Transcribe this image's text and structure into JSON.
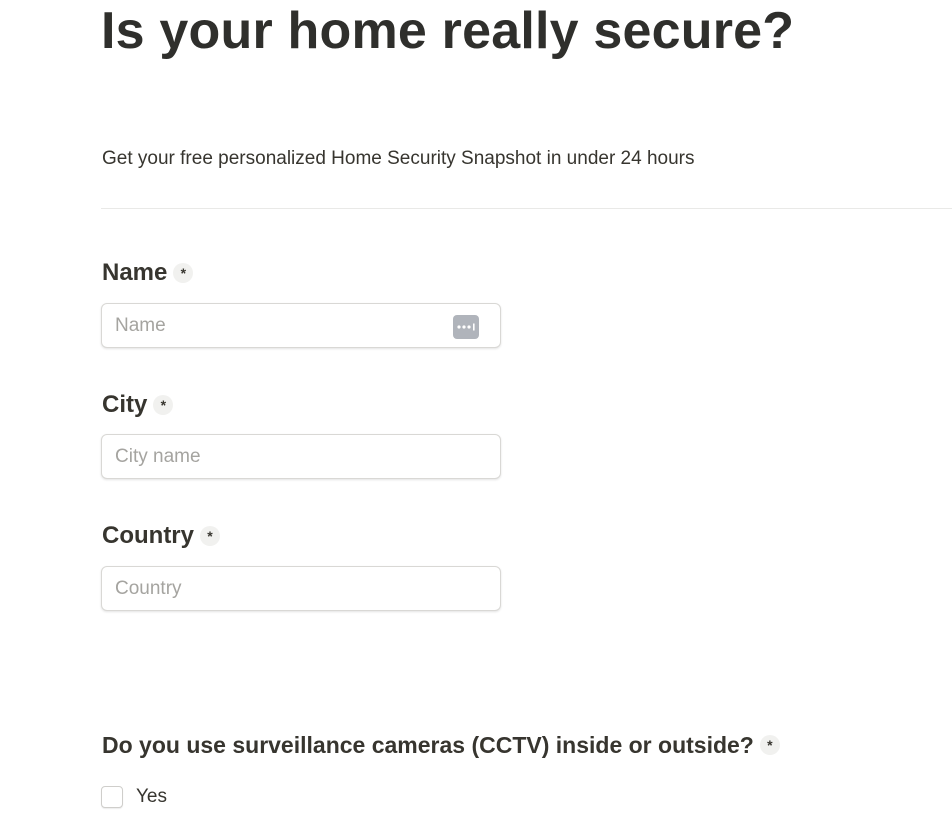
{
  "form": {
    "title": "Is your home really secure?",
    "subtitle": "Get your free personalized Home Security Snapshot in under 24 hours",
    "required_marker": "*",
    "fields": [
      {
        "label": "Name",
        "placeholder": "Name",
        "value": ""
      },
      {
        "label": "City",
        "placeholder": "City name",
        "value": ""
      },
      {
        "label": "Country",
        "placeholder": "Country",
        "value": ""
      }
    ],
    "questions": [
      {
        "label": "Do you use surveillance cameras (CCTV) inside or outside?",
        "options": [
          {
            "label": "Yes",
            "checked": false
          }
        ]
      }
    ]
  },
  "icons": {
    "password_manager": "password-manager-icon"
  },
  "colors": {
    "text": "#37352f",
    "placeholder": "#a5a4a0",
    "border": "#d9d8d5",
    "required_badge_bg": "#f1f1ef",
    "password_icon_bg": "#b0b4bb"
  }
}
